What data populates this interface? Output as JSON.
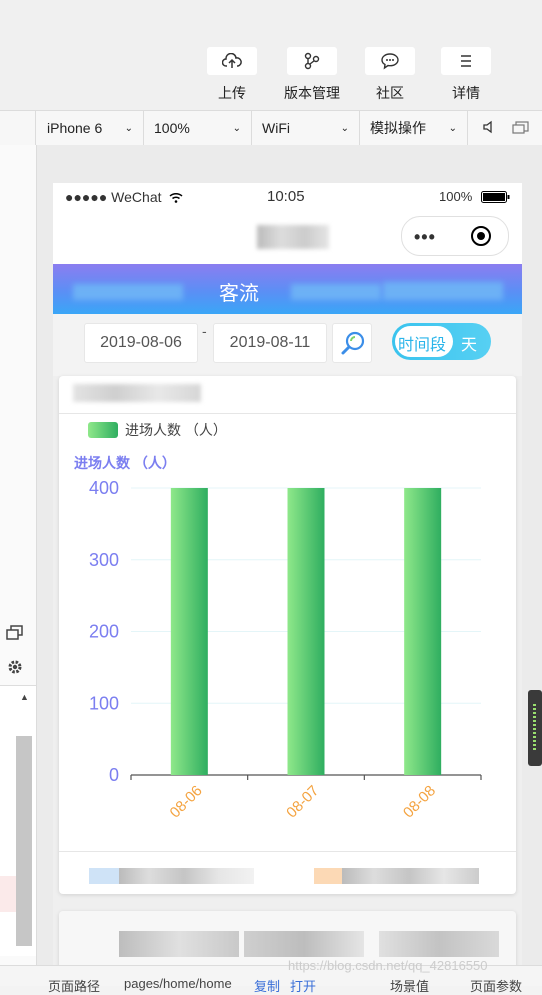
{
  "toolbar": {
    "buttons": [
      {
        "label": "上传",
        "icon": "cloud-upload-icon"
      },
      {
        "label": "版本管理",
        "icon": "branch-icon"
      },
      {
        "label": "社区",
        "icon": "chat-bubble-icon"
      },
      {
        "label": "详情",
        "icon": "menu-lines-icon"
      }
    ]
  },
  "device_bar": {
    "device": "iPhone 6",
    "zoom": "100%",
    "network": "WiFi",
    "simulate": "模拟操作"
  },
  "status_bar": {
    "carrier": "●●●●● WeChat",
    "time": "10:05",
    "battery": "100%"
  },
  "banner": {
    "title": "客流"
  },
  "filter": {
    "start_date": "2019-08-06",
    "dash": "-",
    "end_date": "2019-08-11",
    "toggle_active": "时间段",
    "toggle_inactive": "天"
  },
  "chart_data": {
    "type": "bar",
    "categories": [
      "08-06",
      "08-07",
      "08-08"
    ],
    "series": [
      {
        "name": "进场人数 （人）",
        "values": [
          400,
          400,
          400
        ]
      }
    ],
    "ylabel": "进场人数 （人）",
    "ylim": [
      0,
      400
    ],
    "yticks": [
      "0",
      "100",
      "200",
      "300",
      "400"
    ],
    "legend": "top-left",
    "grid": true,
    "colors": {
      "bar_start": "#8fe88a",
      "bar_end": "#2fae60",
      "axis_text": "#7b7ef0",
      "tick_label": "#f4a340"
    }
  },
  "footer": {
    "page_path_label": "页面路径",
    "page_path": "pages/home/home",
    "copy": "复制",
    "open": "打开",
    "scene": "场景值",
    "params": "页面参数"
  },
  "watermark": "https://blog.csdn.net/qq_42816550"
}
